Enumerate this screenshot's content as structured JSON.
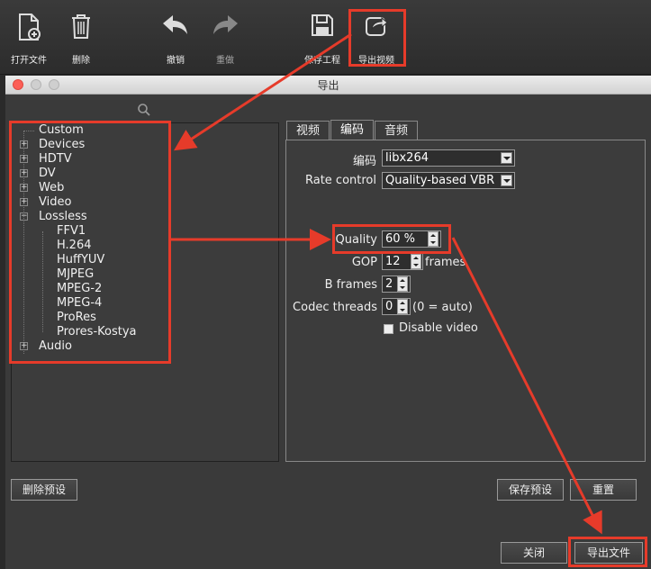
{
  "toolbar": {
    "open_file": "打开文件",
    "delete": "删除",
    "undo": "撤销",
    "redo": "重做",
    "save_project": "保存工程",
    "export_video": "导出视频"
  },
  "dialog": {
    "title": "导出"
  },
  "tree": {
    "items": [
      {
        "label": "Custom"
      },
      {
        "label": "Devices"
      },
      {
        "label": "HDTV"
      },
      {
        "label": "DV"
      },
      {
        "label": "Web"
      },
      {
        "label": "Video"
      },
      {
        "label": "Lossless"
      },
      {
        "label": "FFV1"
      },
      {
        "label": "H.264"
      },
      {
        "label": "HuffYUV"
      },
      {
        "label": "MJPEG"
      },
      {
        "label": "MPEG-2"
      },
      {
        "label": "MPEG-4"
      },
      {
        "label": "ProRes"
      },
      {
        "label": "Prores-Kostya"
      },
      {
        "label": "Audio"
      }
    ]
  },
  "tabs": [
    {
      "label": "视频"
    },
    {
      "label": "编码"
    },
    {
      "label": "音频"
    }
  ],
  "codec": {
    "codec_label": "编码",
    "codec_value": "libx264",
    "rate_control_label": "Rate control",
    "rate_control_value": "Quality-based VBR",
    "quality_label": "Quality",
    "quality_value": "60 %",
    "gop_label": "GOP",
    "gop_value": "12",
    "gop_suffix": "frames",
    "bframes_label": "B frames",
    "bframes_value": "2",
    "threads_label": "Codec threads",
    "threads_value": "0",
    "threads_suffix": "(0 = auto)",
    "disable_video_label": "Disable video"
  },
  "buttons": {
    "delete_preset": "删除预设",
    "save_preset": "保存预设",
    "reset": "重置",
    "close": "关闭",
    "export_file": "导出文件"
  },
  "colors": {
    "highlight": "#e63b2a"
  }
}
